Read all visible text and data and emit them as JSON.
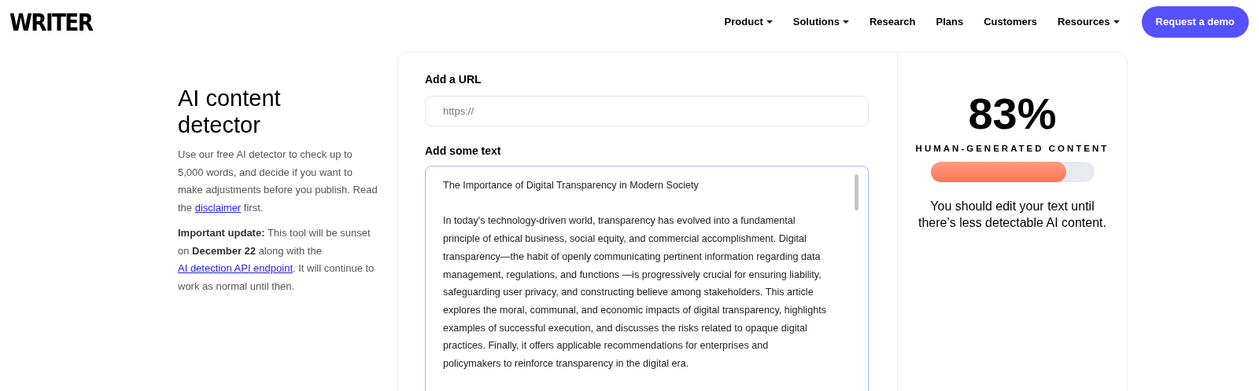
{
  "logo": "WRITER",
  "nav": [
    {
      "label": "Product",
      "dropdown": true
    },
    {
      "label": "Solutions",
      "dropdown": true
    },
    {
      "label": "Research",
      "dropdown": false
    },
    {
      "label": "Plans",
      "dropdown": false
    },
    {
      "label": "Customers",
      "dropdown": false
    },
    {
      "label": "Resources",
      "dropdown": true
    }
  ],
  "cta": "Request a demo",
  "intro": {
    "title": "AI content detector",
    "description": {
      "before": "Use our free AI detector to check up to 5,000 words, and decide if you want to make adjustments before you publish. Read the",
      "link": "disclaimer",
      "after": "first."
    },
    "update": {
      "before": "**Important update:** This tool will be sunset on **December 22** along with the",
      "link": "AI detection API endpoint",
      "after": ". It will continue to work as normal until then."
    }
  },
  "url_field": {
    "label": "Add a URL",
    "placeholder": "https://"
  },
  "text_field": {
    "label": "Add some text",
    "title": "The Importance of Digital Transparency in Modern Society",
    "body": "In today's technology-driven world, transparency has evolved into a fundamental principle of ethical business, social equity, and commercial accomplishment. Digital transparency—the habit of openly communicating pertinent information regarding data management, regulations, and functions —is progressively crucial for ensuring liability, safeguarding user privacy, and constructing believe among stakeholders. This article explores the moral, communal, and economic impacts of digital transparency, highlights examples of successful execution, and discusses the risks related to opaque digital practices. Finally, it offers applicable recommendations for enterprises and policymakers to reinforce transparency in the digital era."
  },
  "result": {
    "score": "83%",
    "label": "HUMAN-GENERATED CONTENT",
    "level": 0.83,
    "message": "You should edit your text until there’s less detectable AI content."
  }
}
